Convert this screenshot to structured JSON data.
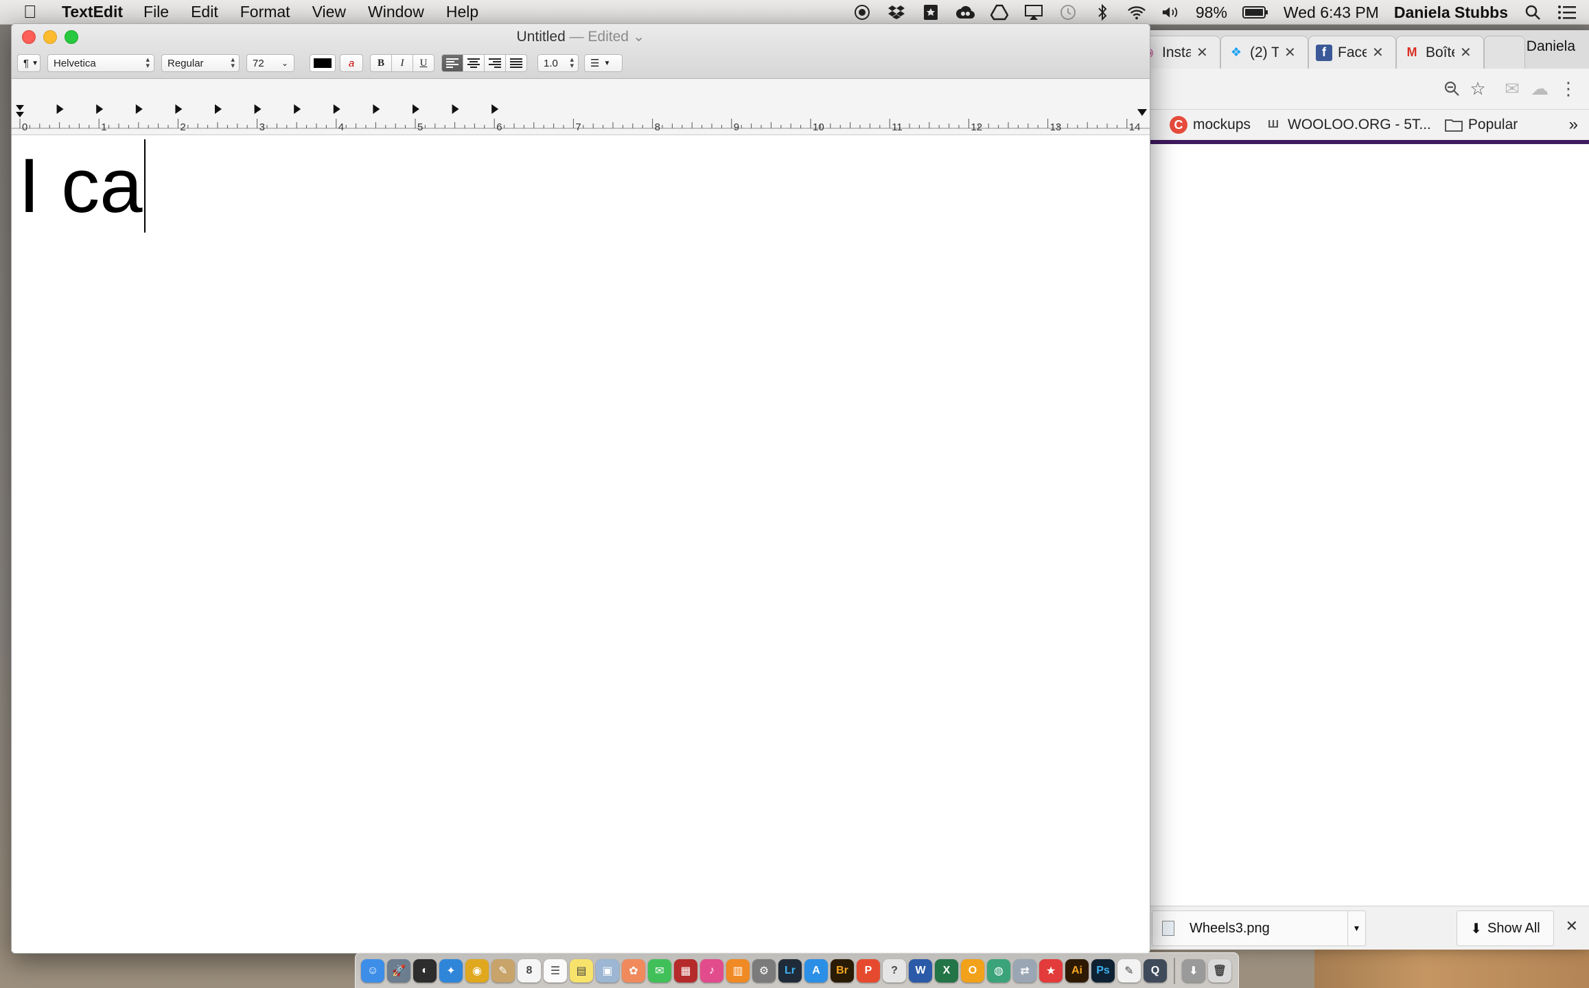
{
  "menubar": {
    "app_name": "TextEdit",
    "menus": [
      "File",
      "Edit",
      "Format",
      "View",
      "Window",
      "Help"
    ],
    "battery": "98%",
    "clock": "Wed 6:43 PM",
    "user": "Daniela Stubbs"
  },
  "textedit": {
    "title": "Untitled",
    "edited": "— Edited",
    "format": {
      "paragraph_icon": "¶",
      "font_family": "Helvetica",
      "font_style": "Regular",
      "font_size": "72",
      "text_color": "#000000",
      "bold": "B",
      "italic": "I",
      "underline": "U",
      "line_spacing": "1.0"
    },
    "ruler_labels": [
      "0",
      "1",
      "2",
      "3",
      "4",
      "5",
      "6",
      "7",
      "8",
      "9",
      "10",
      "11",
      "12",
      "13",
      "14"
    ],
    "document_text": "I ca"
  },
  "chrome": {
    "tabs": [
      {
        "favicon": "instagram-icon",
        "title": "Insta"
      },
      {
        "favicon": "twitter-icon",
        "title": "(2) T"
      },
      {
        "favicon": "facebook-icon",
        "title": "Face"
      },
      {
        "favicon": "gmail-icon",
        "title": "Boîte"
      }
    ],
    "profile": "Daniela",
    "bookmarks": [
      {
        "icon": "c-logo-icon",
        "label": "mockups"
      },
      {
        "icon": "wooloo-icon",
        "label": "WOOLOO.ORG - 5T..."
      },
      {
        "icon": "folder-icon",
        "label": "Popular"
      }
    ],
    "download": {
      "filename": "Wheels3.png",
      "show_all": "Show All"
    }
  },
  "colors": {
    "close": "#fc5f57",
    "minimize": "#fdbc2e",
    "zoom": "#28c840",
    "bookmark_bar_accent": "#3e1a5e"
  },
  "dock_icons": [
    "finder-icon",
    "launchpad-icon",
    "dashboard-icon",
    "safari-icon",
    "chrome-icon",
    "notes-icon",
    "calendar-icon",
    "reminders-icon",
    "stickies-icon",
    "preview-icon",
    "photos-icon",
    "messages-icon",
    "photo-booth-icon",
    "itunes-icon",
    "ibooks-icon",
    "system-preferences-icon",
    "lightroom-icon",
    "app-store-icon",
    "bridge-icon",
    "app-red-icon",
    "help-icon",
    "word-icon",
    "excel-icon",
    "app-orange-icon",
    "network-icon",
    "migration-icon",
    "app-red-square-icon",
    "illustrator-icon",
    "photoshop-icon",
    "textedit-icon",
    "quicktime-icon",
    "downloads-icon",
    "trash-icon"
  ]
}
